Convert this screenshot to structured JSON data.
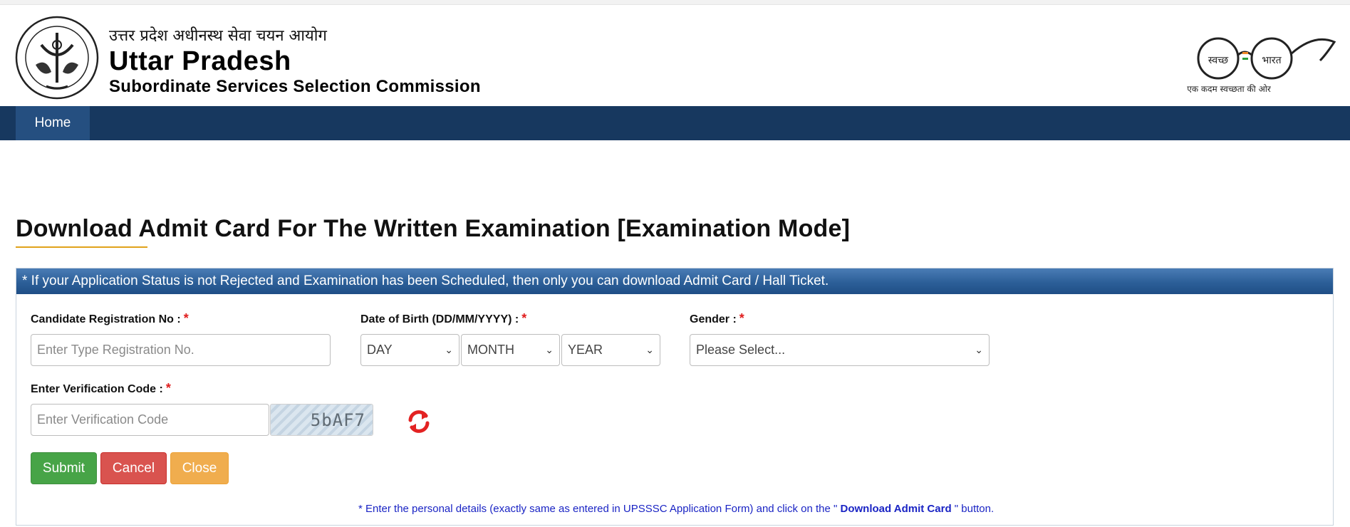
{
  "header": {
    "hindi_title": "उत्तर प्रदेश अधीनस्थ सेवा चयन आयोग",
    "title": "Uttar Pradesh",
    "subtitle": "Subordinate Services Selection Commission",
    "emblem_icon": "up-state-emblem-icon",
    "swachh_logo": {
      "icon": "swachh-bharat-glasses-icon",
      "left_text": "स्वच्छ",
      "right_text": "भारत",
      "tagline": "एक कदम स्वच्छता की ओर"
    }
  },
  "nav": {
    "items": [
      {
        "label": "Home"
      }
    ]
  },
  "page": {
    "title": "Download Admit Card For The Written Examination [Examination Mode]"
  },
  "panel": {
    "notice": "* If your Application Status is not Rejected and Examination has been Scheduled, then only you can download Admit Card / Hall Ticket.",
    "registration": {
      "label": "Candidate Registration No :",
      "placeholder": "Enter Type Registration No.",
      "value": ""
    },
    "dob": {
      "label": "Date of Birth (DD/MM/YYYY) :",
      "day": "DAY",
      "month": "MONTH",
      "year": "YEAR"
    },
    "gender": {
      "label": "Gender :",
      "selected": "Please Select..."
    },
    "verification": {
      "label": "Enter Verification Code :",
      "placeholder": "Enter Verification Code",
      "captcha_text": "5bAF7"
    },
    "required_mark": "*",
    "buttons": {
      "submit": "Submit",
      "cancel": "Cancel",
      "close": "Close"
    },
    "note": {
      "prefix": "* Enter the personal details (exactly same as entered in UPSSSC Application Form) and click on the \"",
      "link": " Download Admit Card ",
      "suffix": "\" button."
    }
  },
  "colors": {
    "nav_bg": "#17385f",
    "nav_active": "#254f80",
    "panel_head": "#2c5f98",
    "submit": "#47a447",
    "cancel": "#d9534f",
    "close": "#f0ad4e",
    "required": "#e01e1e",
    "note": "#1a24c4",
    "title_underline": "#e0a21b"
  }
}
